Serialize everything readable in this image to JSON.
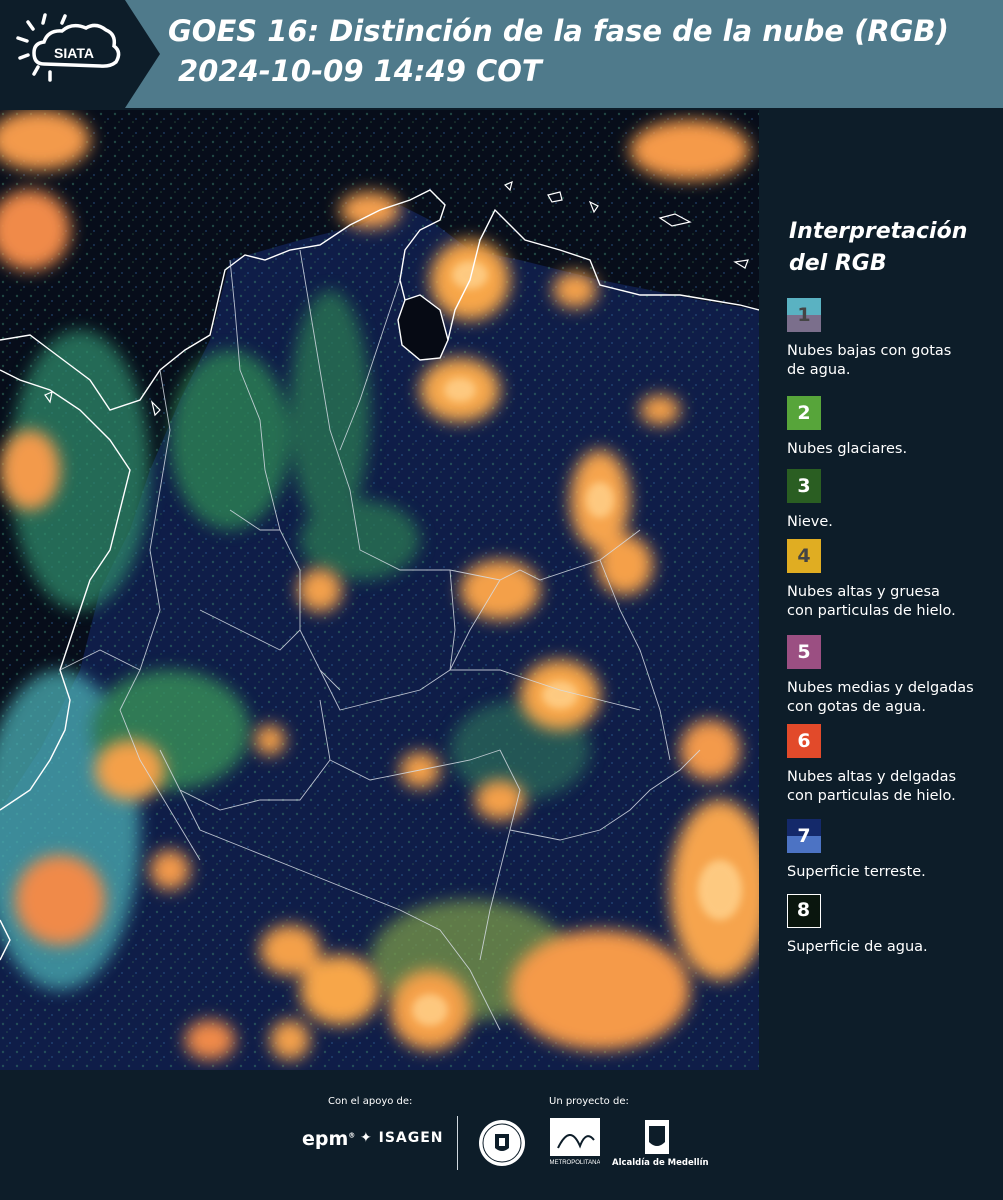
{
  "header": {
    "logo_text": "SIATA",
    "title": "GOES 16: Distinción de la fase de la nube (RGB)",
    "datetime": "2024-10-09 14:49 COT"
  },
  "legend": {
    "title_line1": "Interpretación",
    "title_line2": "del RGB",
    "items": [
      {
        "number": "1",
        "label_lines": [
          "Nubes bajas con gotas",
          "de agua."
        ],
        "color_top": "#5ab2c2",
        "color_bottom": "#7b6f8c",
        "number_color": "#444444"
      },
      {
        "number": "2",
        "label_lines": [
          "Nubes glaciares."
        ],
        "color_top": "#57a53a",
        "color_bottom": "#57a53a",
        "number_color": "#ffffff"
      },
      {
        "number": "3",
        "label_lines": [
          "Nieve."
        ],
        "color_top": "#2a5e22",
        "color_bottom": "#2a5e22",
        "number_color": "#ffffff"
      },
      {
        "number": "4",
        "label_lines": [
          "Nubes altas y gruesa",
          "con particulas de hielo."
        ],
        "color_top": "#e0ad22",
        "color_bottom": "#e0ad22",
        "number_color": "#444444"
      },
      {
        "number": "5",
        "label_lines": [
          "Nubes medias y delgadas",
          "con gotas de agua."
        ],
        "color_top": "#9b4f82",
        "color_bottom": "#9b4f82",
        "number_color": "#ffffff"
      },
      {
        "number": "6",
        "label_lines": [
          "Nubes altas y delgadas",
          "con particulas de hielo."
        ],
        "color_top": "#e24a2a",
        "color_bottom": "#e24a2a",
        "number_color": "#ffffff"
      },
      {
        "number": "7",
        "label_lines": [
          "Superficie terreste."
        ],
        "color_top": "#14296a",
        "color_bottom": "#4c73c4",
        "number_color": "#ffffff"
      },
      {
        "number": "8",
        "label_lines": [
          "Superficie de agua."
        ],
        "color_top": "#0a160e",
        "color_bottom": "#0a160e",
        "number_color": "#ffffff"
      }
    ]
  },
  "footer": {
    "support_label": "Con el apoyo de:",
    "project_label": "Un proyecto de:",
    "epm_logo": "epm",
    "isagen_logo": "ISAGEN",
    "amva_logo": "Área Metropolitana Valle de Aburrá",
    "alcaldia_logo": "Alcaldía de Medellín"
  },
  "colors": {
    "header_bg": "#4f7a8b",
    "logo_bg": "#0d1d29",
    "page_bg": "#0d1d29",
    "map_land": "#0e1a3f",
    "cloud_orange": "#f5a04a",
    "cloud_green": "#4fb86a",
    "cloud_cyan": "#5fc9c9"
  }
}
